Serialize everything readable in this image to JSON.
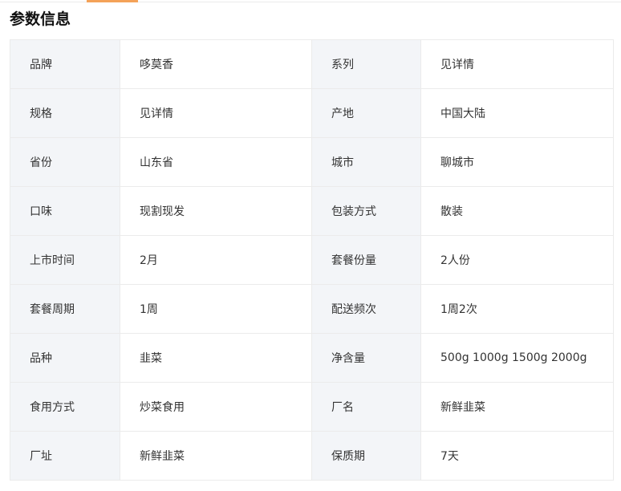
{
  "section": {
    "title": "参数信息"
  },
  "rows": [
    {
      "k1": "品牌",
      "v1": "哆莫香",
      "k2": "系列",
      "v2": "见详情"
    },
    {
      "k1": "规格",
      "v1": "见详情",
      "k2": "产地",
      "v2": "中国大陆"
    },
    {
      "k1": "省份",
      "v1": "山东省",
      "k2": "城市",
      "v2": "聊城市"
    },
    {
      "k1": "口味",
      "v1": "现割现发",
      "k2": "包装方式",
      "v2": "散装"
    },
    {
      "k1": "上市时间",
      "v1": "2月",
      "k2": "套餐份量",
      "v2": "2人份"
    },
    {
      "k1": "套餐周期",
      "v1": "1周",
      "k2": "配送频次",
      "v2": "1周2次"
    },
    {
      "k1": "品种",
      "v1": "韭菜",
      "k2": "净含量",
      "v2": "500g 1000g 1500g 2000g"
    },
    {
      "k1": "食用方式",
      "v1": "炒菜食用",
      "k2": "厂名",
      "v2": "新鲜韭菜"
    },
    {
      "k1": "厂址",
      "v1": "新鲜韭菜",
      "k2": "保质期",
      "v2": "7天"
    }
  ],
  "colors": {
    "key_background": "#f3f5f8",
    "border": "#ebebeb",
    "tab_indicator": "#f4a259",
    "text": "#333333"
  }
}
